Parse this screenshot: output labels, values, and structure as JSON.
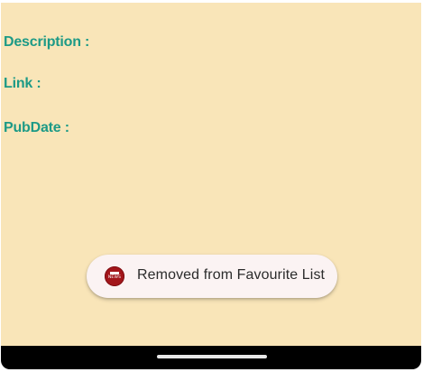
{
  "details": {
    "description_label": "Description :",
    "link_label": "Link :",
    "pubdate_label": "PubDate :"
  },
  "toast": {
    "app_icon": "bbc-news-icon",
    "icon_lettering": "NEWS",
    "message": "Removed from Favourite List"
  },
  "colors": {
    "background": "#f9e5b8",
    "label": "#1d9a86",
    "toast_background": "#fbf3f3",
    "icon_red": "#a3161b",
    "nav_bar": "#000000"
  }
}
